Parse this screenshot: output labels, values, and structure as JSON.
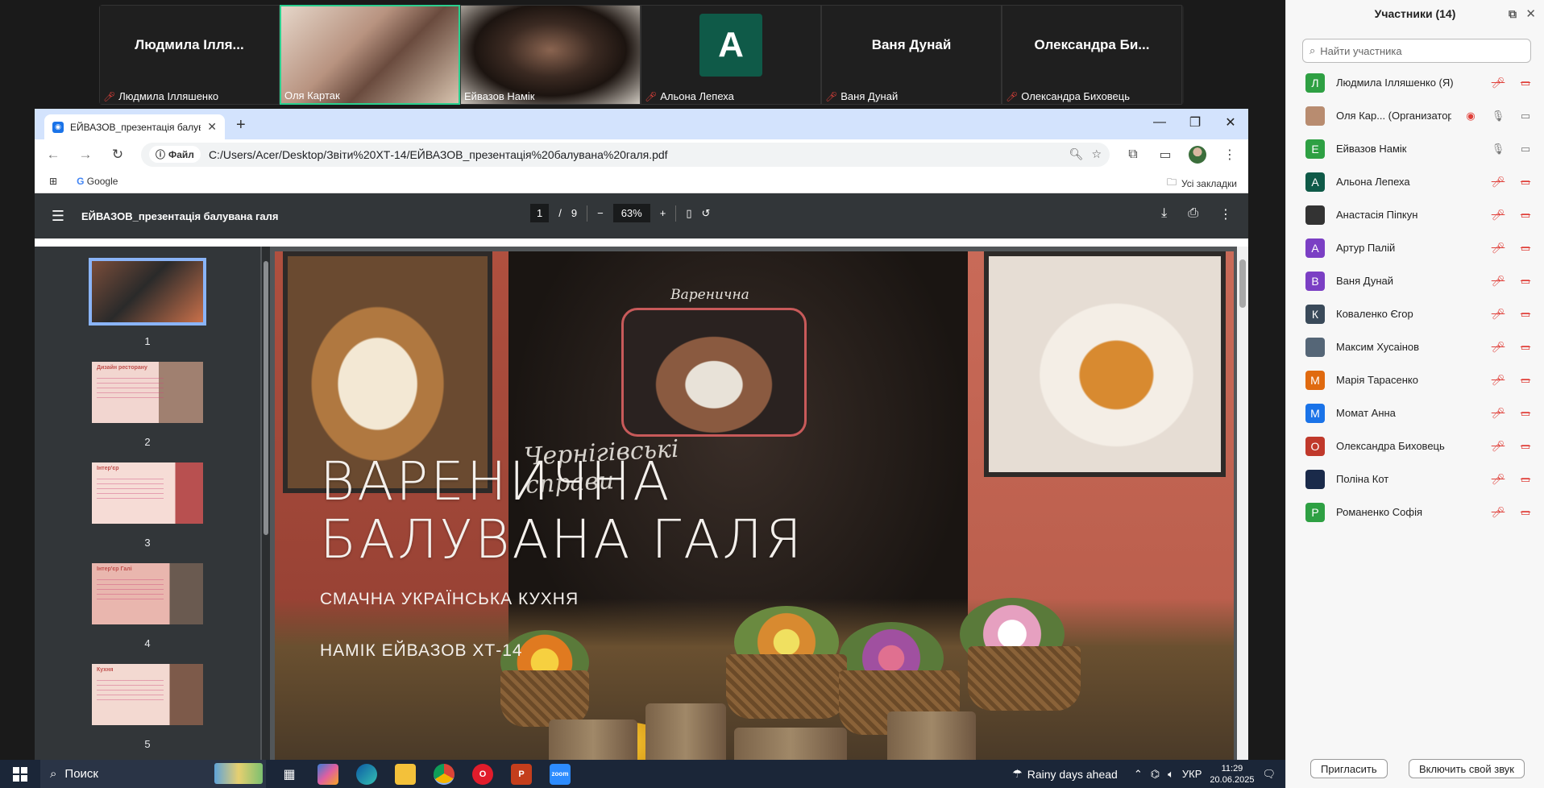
{
  "zoom": {
    "tiles": [
      {
        "big_name": "Людмила Ілля...",
        "caption": "Людмила Ілляшенко",
        "muted": true,
        "type": "name"
      },
      {
        "big_name": "",
        "caption": "Оля Картак",
        "muted": false,
        "type": "video1",
        "active": true
      },
      {
        "big_name": "",
        "caption": "Ейвазов Намік",
        "muted": false,
        "type": "video2"
      },
      {
        "big_name": "A",
        "caption": "Альона Лепеха",
        "muted": true,
        "type": "avatar"
      },
      {
        "big_name": "Ваня Дунай",
        "caption": "Ваня Дунай",
        "muted": true,
        "type": "name"
      },
      {
        "big_name": "Олександра  Би...",
        "caption": "Олександра Биховець",
        "muted": true,
        "type": "name"
      }
    ]
  },
  "browser": {
    "tab_title": "ЕЙВАЗОВ_презентація балува",
    "url": "C:/Users/Acer/Desktop/Звіти%20ХТ-14/ЕЙВАЗОВ_презентація%20балувана%20галя.pdf",
    "chip_label": "Файл",
    "bookmark_google": "Google",
    "all_bookmarks": "Усі закладки"
  },
  "pdf": {
    "title": "ЕЙВАЗОВ_презентація балувана галя",
    "page_current": "1",
    "page_sep": "/",
    "page_total": "9",
    "zoom": "63%",
    "thumbnails": [
      {
        "num": "1",
        "label": ""
      },
      {
        "num": "2",
        "label": "Дизайн ресторану"
      },
      {
        "num": "3",
        "label": "Інтер'єр"
      },
      {
        "num": "4",
        "label": "Інтер'єр Галі"
      },
      {
        "num": "5",
        "label": "Кухня"
      }
    ],
    "slide": {
      "sign_title": "Варенична",
      "sign_subtitle": "Чернігівські справи",
      "title_line1": "ВАРЕНИЧНА",
      "title_line2": "БАЛУВАНА ГАЛЯ",
      "subtitle": "СМАЧНА УКРАЇНСЬКА КУХНЯ",
      "author": "НАМІК ЕЙВАЗОВ ХТ-14"
    }
  },
  "participants": {
    "title": "Участники (14)",
    "search_placeholder": "Найти участника",
    "list": [
      {
        "initial": "Л",
        "color": "#2ea043",
        "name": "Людмила Ілляшенко (Я)",
        "mic": "off",
        "cam": "off"
      },
      {
        "initial": "",
        "color": "#b88c70",
        "name": "Оля Кар... (Организатор)",
        "mic": "on",
        "cam": "on",
        "host": true
      },
      {
        "initial": "Е",
        "color": "#2ea043",
        "name": "Ейвазов Намік",
        "mic": "on",
        "cam": "on"
      },
      {
        "initial": "А",
        "color": "#0f5a48",
        "name": "Альона Лепеха",
        "mic": "off",
        "cam": "off"
      },
      {
        "initial": "",
        "color": "#333333",
        "name": "Анастасія Піпкун",
        "mic": "off",
        "cam": "off"
      },
      {
        "initial": "А",
        "color": "#7b3fc4",
        "name": "Артур Палій",
        "mic": "off",
        "cam": "off"
      },
      {
        "initial": "В",
        "color": "#7b3fc4",
        "name": "Ваня Дунай",
        "mic": "off",
        "cam": "off"
      },
      {
        "initial": "К",
        "color": "#3a4a5a",
        "name": "Коваленко Єгор",
        "mic": "off",
        "cam": "off"
      },
      {
        "initial": "",
        "color": "#556677",
        "name": "Максим Хусаінов",
        "mic": "off",
        "cam": "off"
      },
      {
        "initial": "М",
        "color": "#e06a10",
        "name": "Марія Тарасенко",
        "mic": "off",
        "cam": "off"
      },
      {
        "initial": "М",
        "color": "#1a73e8",
        "name": "Момат Анна",
        "mic": "off",
        "cam": "off"
      },
      {
        "initial": "О",
        "color": "#c0392b",
        "name": "Олександра Биховець",
        "mic": "off",
        "cam": "off"
      },
      {
        "initial": "",
        "color": "#1a2a4a",
        "name": "Поліна Кот",
        "mic": "off",
        "cam": "off"
      },
      {
        "initial": "Р",
        "color": "#2ea043",
        "name": "Романенко Софія",
        "mic": "off",
        "cam": "off"
      }
    ],
    "invite_label": "Пригласить",
    "unmute_label": "Включить свой звук"
  },
  "taskbar": {
    "search_label": "Поиск",
    "weather": "Rainy days ahead",
    "lang": "УКР",
    "time": "11:29",
    "date": "20.06.2025"
  }
}
